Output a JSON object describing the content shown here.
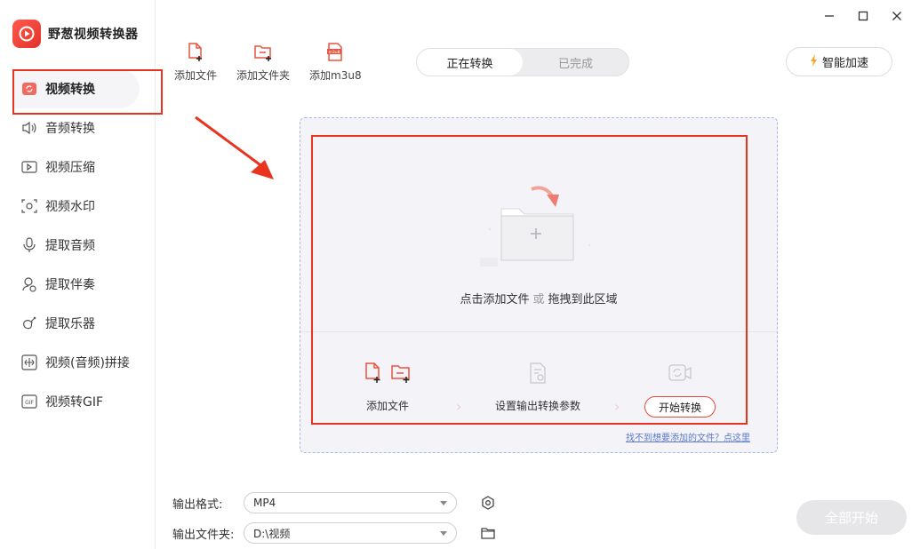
{
  "app": {
    "title": "野葱视频转换器",
    "accent": "#e9331f"
  },
  "sidebar": {
    "items": [
      {
        "label": "视频转换",
        "icon": "video-convert-icon",
        "active": true
      },
      {
        "label": "音频转换",
        "icon": "audio-icon"
      },
      {
        "label": "视频压缩",
        "icon": "compress-icon"
      },
      {
        "label": "视频水印",
        "icon": "watermark-icon"
      },
      {
        "label": "提取音频",
        "icon": "microphone-icon"
      },
      {
        "label": "提取伴奏",
        "icon": "accompaniment-icon"
      },
      {
        "label": "提取乐器",
        "icon": "guitar-icon"
      },
      {
        "label": "视频(音频)拼接",
        "icon": "merge-icon"
      },
      {
        "label": "视频转GIF",
        "icon": "gif-icon"
      }
    ]
  },
  "toolbar": {
    "add_file": "添加文件",
    "add_folder": "添加文件夹",
    "add_m3u8": "添加m3u8"
  },
  "tabs": [
    {
      "label": "正在转换",
      "active": true
    },
    {
      "label": "已完成",
      "active": false
    }
  ],
  "smart_accel": "智能加速",
  "dropzone": {
    "hint_click": "点击添加文件",
    "hint_or": "或",
    "hint_drag": "拖拽到此区域",
    "step1": "添加文件",
    "step2": "设置输出转换参数",
    "step3": "开始转换",
    "help_link": "找不到想要添加的文件？点这里"
  },
  "output": {
    "format_label": "输出格式:",
    "format_value": "MP4",
    "folder_label": "输出文件夹:",
    "folder_value": "D:\\视频"
  },
  "start_all": "全部开始"
}
